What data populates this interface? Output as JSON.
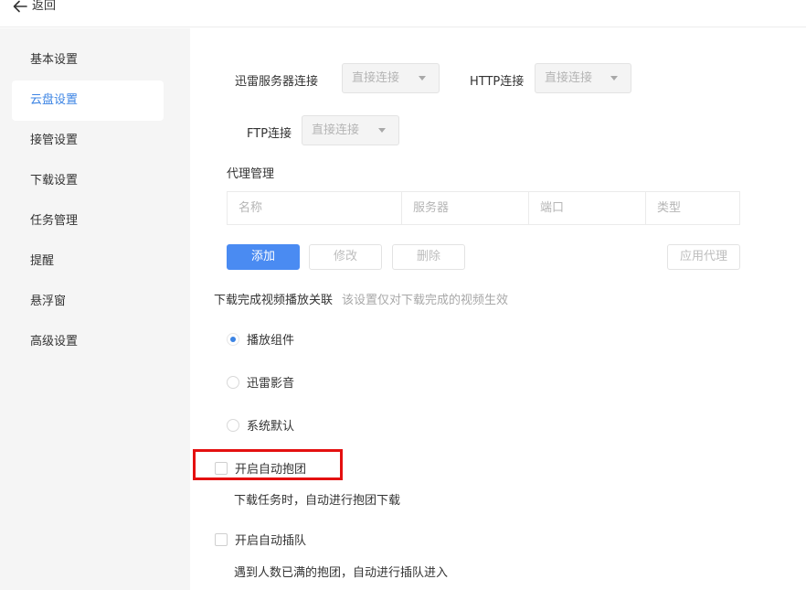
{
  "header": {
    "back_label": "返回"
  },
  "sidebar": {
    "items": [
      {
        "label": "基本设置"
      },
      {
        "label": "云盘设置"
      },
      {
        "label": "接管设置"
      },
      {
        "label": "下载设置"
      },
      {
        "label": "任务管理"
      },
      {
        "label": "提醒"
      },
      {
        "label": "悬浮窗"
      },
      {
        "label": "高级设置"
      }
    ],
    "active": "云盘设置"
  },
  "connection": {
    "server_label": "迅雷服务器连接",
    "server_value": "直接连接",
    "http_label": "HTTP连接",
    "http_value": "直接连接",
    "ftp_label": "FTP连接",
    "ftp_value": "直接连接"
  },
  "proxy": {
    "title": "代理管理",
    "columns": [
      "名称",
      "服务器",
      "端口",
      "类型"
    ],
    "add_label": "添加",
    "edit_label": "修改",
    "delete_label": "删除",
    "apply_label": "应用代理"
  },
  "video": {
    "title": "下载完成视频播放关联",
    "hint": "该设置仅对下载完成的视频生效",
    "options": [
      {
        "label": "播放组件",
        "checked": true
      },
      {
        "label": "迅雷影音",
        "checked": false
      },
      {
        "label": "系统默认",
        "checked": false
      }
    ]
  },
  "auto_group": {
    "label": "开启自动抱团",
    "desc": "下载任务时，自动进行抱团下载"
  },
  "auto_queue": {
    "label": "开启自动插队",
    "desc": "遇到人数已满的抱团，自动进行插队进入"
  },
  "colors": {
    "accent": "#3c84e4",
    "primary_button": "#4a8bf2",
    "highlight": "#e41010"
  }
}
